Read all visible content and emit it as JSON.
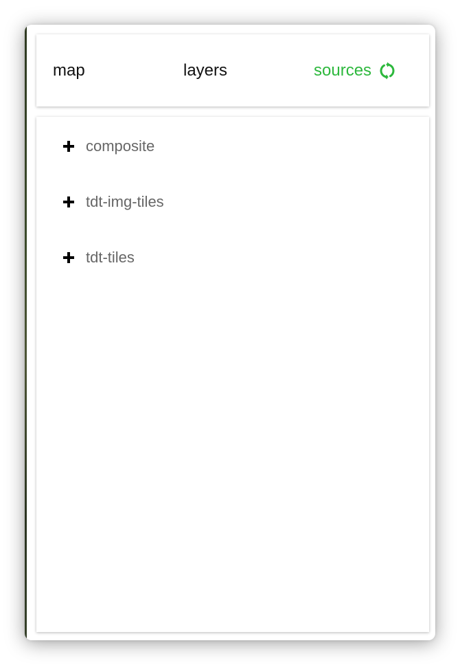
{
  "tabs": {
    "map": "map",
    "layers": "layers",
    "sources": "sources",
    "active": "sources"
  },
  "icons": {
    "refresh": "refresh-icon",
    "expand": "plus-icon"
  },
  "colors": {
    "active_tab": "#2db83d",
    "source_text": "#666666"
  },
  "sources": [
    {
      "name": "composite"
    },
    {
      "name": "tdt-img-tiles"
    },
    {
      "name": "tdt-tiles"
    }
  ]
}
